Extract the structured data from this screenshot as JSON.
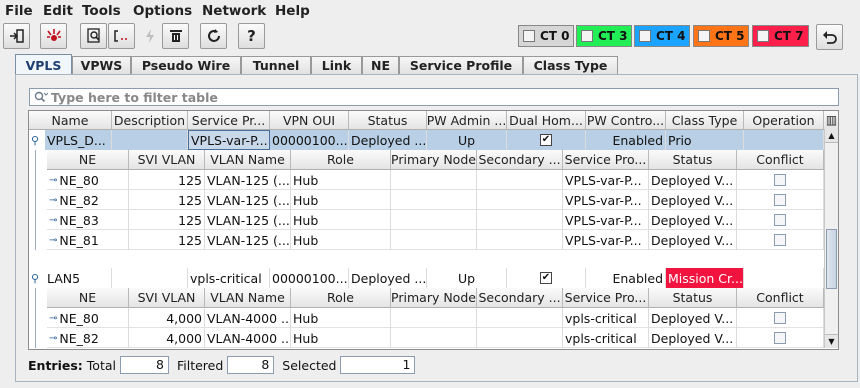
{
  "menu": [
    "File",
    "Edit",
    "Tools",
    "Options",
    "Network",
    "Help"
  ],
  "toolbar": {
    "icons": [
      "exit-icon",
      "alarm-icon",
      "inspect-icon",
      "bracket-icon",
      "lightning-icon",
      "delete-icon",
      "refresh-icon",
      "help-icon"
    ],
    "help_label": "?",
    "ct_buttons": [
      {
        "label": "CT 0",
        "color": "#d6d6d6"
      },
      {
        "label": "CT 3",
        "color": "#22ee55"
      },
      {
        "label": "CT 4",
        "color": "#1aa3ff"
      },
      {
        "label": "CT 5",
        "color": "#ff7417"
      },
      {
        "label": "CT 7",
        "color": "#ff1f4b"
      }
    ],
    "undo_icon": "undo-icon"
  },
  "tabs": [
    "VPLS",
    "VPWS",
    "Pseudo Wire",
    "Tunnel",
    "Link",
    "NE",
    "Service Profile",
    "Class Type"
  ],
  "filter": {
    "placeholder": "Type here to filter table"
  },
  "table": {
    "columns": [
      "Name",
      "Description",
      "Service Pr...",
      "VPN OUI",
      "Status",
      "PW Admin ...",
      "Dual Hom...",
      "PW Contro...",
      "Class Type",
      "Operation"
    ],
    "sub_columns": [
      "NE",
      "SVI VLAN",
      "VLAN Name",
      "Role",
      "Primary Node",
      "Secondary ...",
      "Service Pro...",
      "Status",
      "Conflict"
    ],
    "groups": [
      {
        "name": "VPLS_D...",
        "description": "",
        "service_profile": "VPLS-var-P...",
        "vpn_oui": "00000100...",
        "status": "Deployed ...",
        "pw_admin": "Up",
        "dual_homed": true,
        "pw_control": "Enabled",
        "class_type": "Prio",
        "class_type_color": "",
        "operation": "",
        "rows": [
          {
            "ne": "NE_80",
            "svi_vlan": "125",
            "vlan_name": "VLAN-125 (...",
            "role": "Hub",
            "primary": "",
            "secondary": "",
            "service_profile": "VPLS-var-P...",
            "status": "Deployed V..."
          },
          {
            "ne": "NE_82",
            "svi_vlan": "125",
            "vlan_name": "VLAN-125 (...",
            "role": "Hub",
            "primary": "",
            "secondary": "",
            "service_profile": "VPLS-var-P...",
            "status": "Deployed V..."
          },
          {
            "ne": "NE_83",
            "svi_vlan": "125",
            "vlan_name": "VLAN-125 (...",
            "role": "Hub",
            "primary": "",
            "secondary": "",
            "service_profile": "VPLS-var-P...",
            "status": "Deployed V..."
          },
          {
            "ne": "NE_81",
            "svi_vlan": "125",
            "vlan_name": "VLAN-125 (...",
            "role": "Hub",
            "primary": "",
            "secondary": "",
            "service_profile": "VPLS-var-P...",
            "status": "Deployed V..."
          }
        ]
      },
      {
        "name": "LAN5",
        "description": "",
        "service_profile": "vpls-critical",
        "vpn_oui": "00000100...",
        "status": "Deployed ...",
        "pw_admin": "Up",
        "dual_homed": true,
        "pw_control": "Enabled",
        "class_type": "Mission Cr...",
        "class_type_color": "#f2133f",
        "operation": "",
        "rows": [
          {
            "ne": "NE_80",
            "svi_vlan": "4,000",
            "vlan_name": "VLAN-4000 ...",
            "role": "Hub",
            "primary": "",
            "secondary": "",
            "service_profile": "vpls-critical",
            "status": "Deployed V..."
          },
          {
            "ne": "NE_82",
            "svi_vlan": "4,000",
            "vlan_name": "VLAN-4000 ...",
            "role": "Hub",
            "primary": "",
            "secondary": "",
            "service_profile": "vpls-critical",
            "status": "Deployed V..."
          }
        ]
      }
    ]
  },
  "status": {
    "entries_label": "Entries:",
    "total_label": "Total",
    "total": "8",
    "filtered_label": "Filtered",
    "filtered": "8",
    "selected_label": "Selected",
    "selected": "1"
  }
}
